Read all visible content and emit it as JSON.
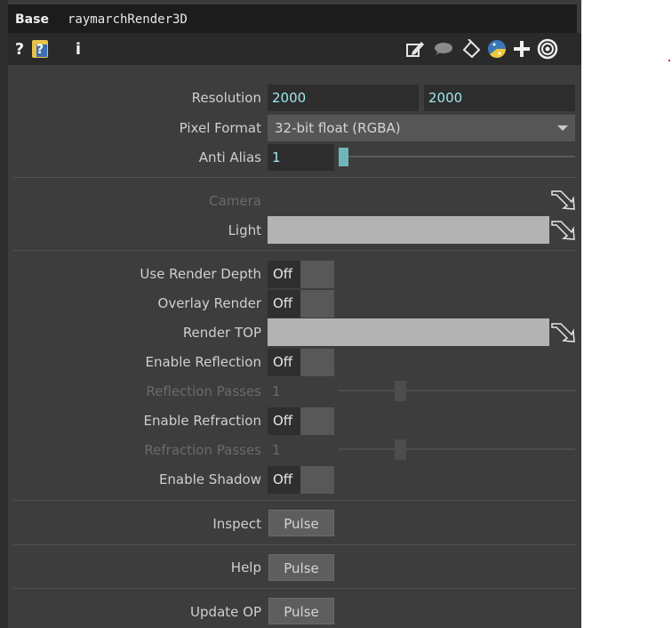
{
  "header": {
    "op_type": "Base",
    "op_name": "raymarchRender3D"
  },
  "toolbar": {
    "left": {
      "help": "?",
      "info": "i"
    },
    "right_icons": [
      "edit-icon",
      "comment-icon",
      "paint-bucket-icon",
      "python-icon",
      "plus-icon",
      "target-icon"
    ]
  },
  "params": {
    "resolution": {
      "label": "Resolution",
      "w": "2000",
      "h": "2000"
    },
    "pixel_format": {
      "label": "Pixel Format",
      "value": "32-bit float (RGBA)"
    },
    "anti_alias": {
      "label": "Anti Alias",
      "value": "1"
    },
    "camera": {
      "label": "Camera"
    },
    "light": {
      "label": "Light",
      "value": ""
    },
    "use_render_depth": {
      "label": "Use Render Depth",
      "value": "Off"
    },
    "overlay_render": {
      "label": "Overlay Render",
      "value": "Off"
    },
    "render_top": {
      "label": "Render TOP",
      "value": ""
    },
    "enable_reflection": {
      "label": "Enable Reflection",
      "value": "Off"
    },
    "reflection_passes": {
      "label": "Reflection Passes",
      "value": "1"
    },
    "enable_refraction": {
      "label": "Enable Refraction",
      "value": "Off"
    },
    "refraction_passes": {
      "label": "Refraction Passes",
      "value": "1"
    },
    "enable_shadow": {
      "label": "Enable Shadow",
      "value": "Off"
    },
    "inspect": {
      "label": "Inspect",
      "button": "Pulse"
    },
    "help": {
      "label": "Help",
      "button": "Pulse"
    },
    "update_op": {
      "label": "Update OP",
      "button": "Pulse"
    }
  },
  "colors": {
    "panel_bg": "#3d3d3d",
    "titlebar_bg": "#1c1c1c",
    "value_text": "#9ee7ee",
    "slider_handle_active": "#6fb6bb",
    "op_field": "#b3b3b3"
  }
}
